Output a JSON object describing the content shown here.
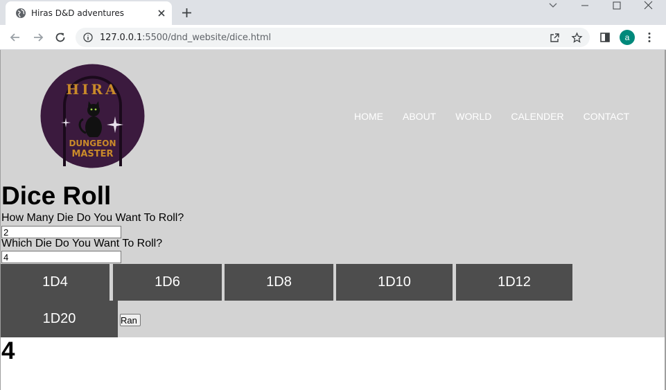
{
  "browser": {
    "tab_title": "Hiras D&D adventures",
    "url_host": "127.0.0.1",
    "url_rest": ":5500/dnd_website/dice.html",
    "profile_initial": "a",
    "profile_color": "#00897b"
  },
  "logo": {
    "top_text": "HIRA",
    "bottom_text_1": "DUNGEON",
    "bottom_text_2": "MASTER"
  },
  "nav": {
    "items": [
      "HOME",
      "ABOUT",
      "WORLD",
      "CALENDER",
      "CONTACT"
    ]
  },
  "main": {
    "title": "Dice Roll",
    "count_label": "How Many Die Do You Want To Roll?",
    "count_value": "2",
    "die_label": "Which Die Do You Want To Roll?",
    "die_value": "4",
    "dice_buttons": [
      "1D4",
      "1D6",
      "1D8",
      "1D10",
      "1D12",
      "1D20"
    ],
    "roll_button": "Ran",
    "result": "4"
  },
  "colors": {
    "header_bg": "#d3d3d3",
    "dice_button_bg": "#4d4d4d",
    "logo_bg": "#3b1a3e",
    "logo_accent": "#c98a2a"
  }
}
